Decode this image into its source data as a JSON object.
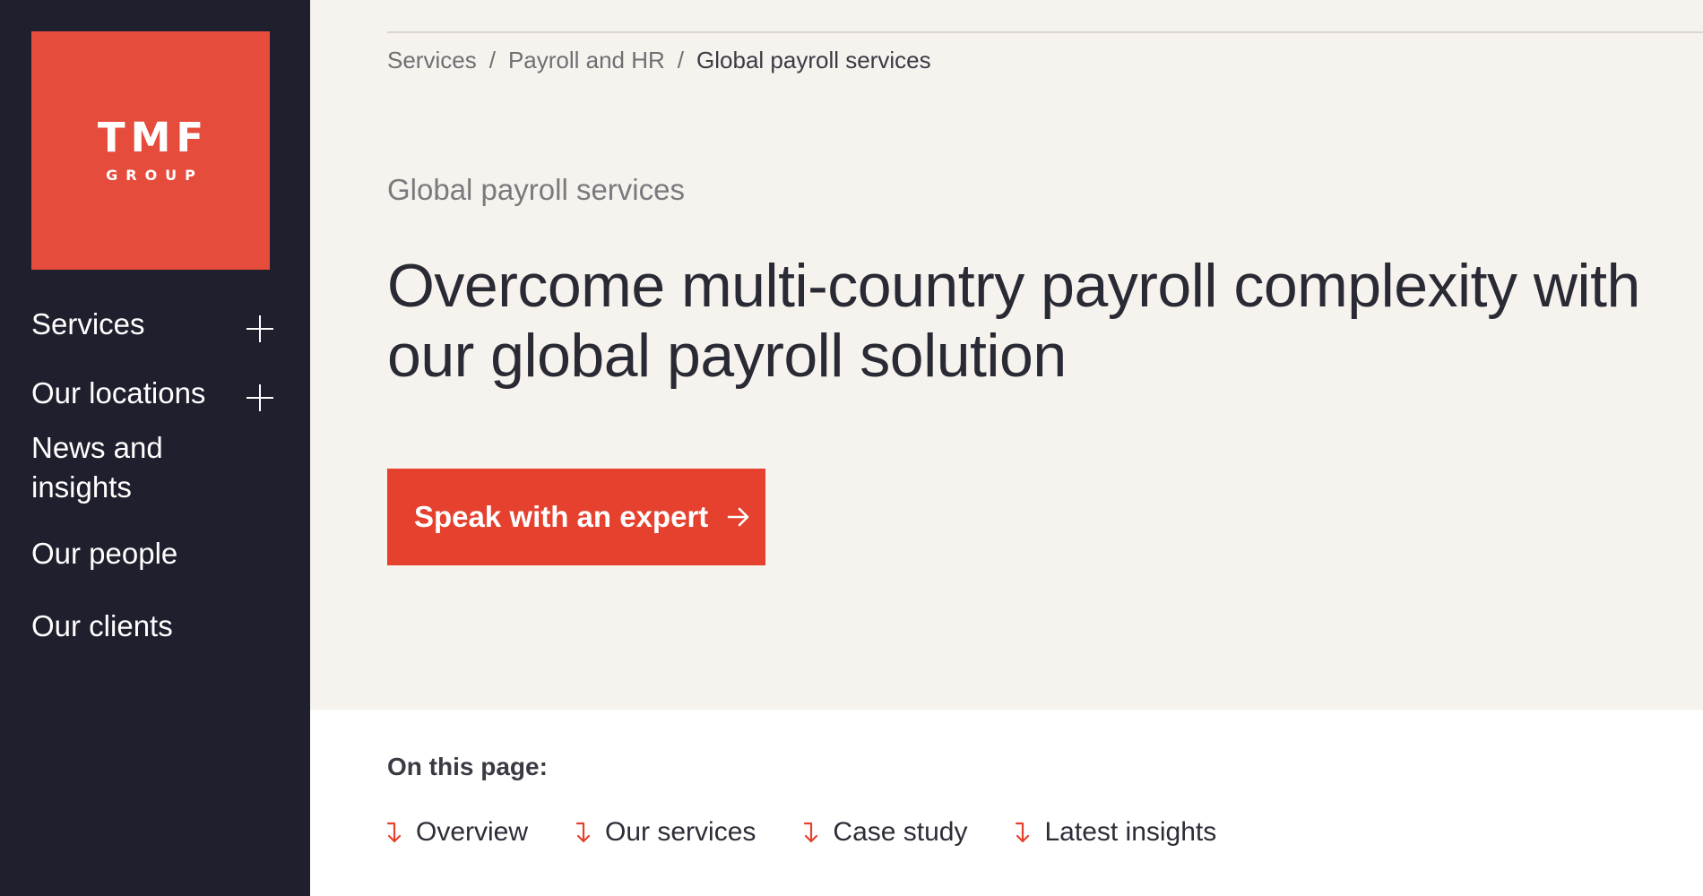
{
  "logo": {
    "main": "TMF",
    "sub": "GROUP"
  },
  "nav": {
    "items": [
      {
        "label": "Services",
        "expandable": true
      },
      {
        "label": "Our locations",
        "expandable": true
      },
      {
        "label": "News and insights",
        "expandable": false
      },
      {
        "label": "Our people",
        "expandable": false
      },
      {
        "label": "Our clients",
        "expandable": false
      }
    ]
  },
  "breadcrumb": {
    "items": [
      "Services",
      "Payroll and HR",
      "Global payroll services"
    ],
    "separator": "/"
  },
  "hero": {
    "eyebrow": "Global payroll services",
    "headline": "Overcome multi-country payroll complexity with our global payroll solution",
    "cta_label": "Speak with an expert"
  },
  "on_this_page": {
    "label": "On this page:",
    "links": [
      "Overview",
      "Our services",
      "Case study",
      "Latest insights"
    ]
  },
  "colors": {
    "accent": "#e5412e",
    "logo_bg": "#e64c3c",
    "sidebar_bg": "#1f1f2d",
    "hero_bg": "#f6f3ee",
    "lower_bg": "#ffffff"
  },
  "icons": {
    "expand": "plus-icon",
    "cta_arrow": "arrow-right-icon",
    "anchor": "arrow-down-icon"
  }
}
